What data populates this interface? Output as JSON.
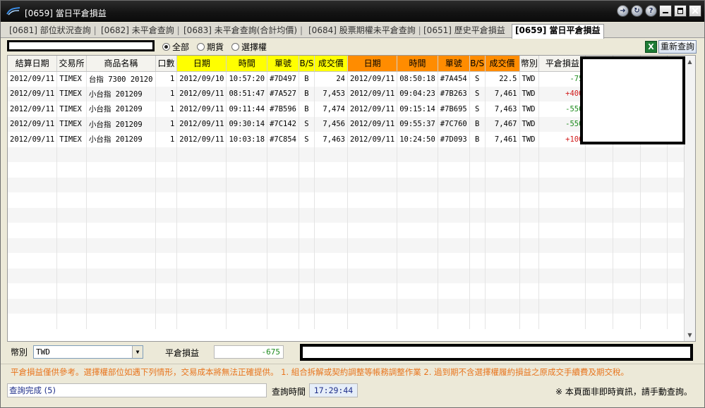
{
  "window": {
    "title": "[0659] 當日平倉損益"
  },
  "titlebar_buttons": [
    "forward-icon",
    "refresh-icon",
    "help-icon",
    "minimize-icon",
    "maximize-icon",
    "close-icon"
  ],
  "tabs": [
    {
      "label": "[0681] 部位狀況查詢",
      "active": false
    },
    {
      "label": "[0682] 未平倉查詢",
      "active": false
    },
    {
      "label": "[0683] 未平倉查詢(合計均價)",
      "active": false
    },
    {
      "label": "[0684] 股票期權未平倉查詢",
      "active": false
    },
    {
      "label": "[0651] 歷史平倉損益",
      "active": false
    },
    {
      "label": "[0659] 當日平倉損益",
      "active": true
    }
  ],
  "filters": {
    "options": [
      {
        "label": "全部",
        "selected": true
      },
      {
        "label": "期貨",
        "selected": false
      },
      {
        "label": "選擇權",
        "selected": false
      }
    ],
    "refresh_label": "重新查詢"
  },
  "columns": [
    "結算日期",
    "交易所",
    "商品名稱",
    "口數",
    "日期",
    "時間",
    "單號",
    "B/S",
    "成交價",
    "日期",
    "時間",
    "單號",
    "B/S",
    "成交價",
    "幣別",
    "平倉損益"
  ],
  "rows": [
    {
      "settle_date": "2012/09/11",
      "exchange": "TIMEX",
      "product": "台指 7300 20120",
      "qty": "1",
      "o_date": "2012/09/10",
      "o_time": "10:57:20",
      "o_no": "#7D497",
      "o_bs": "B",
      "o_price": "24",
      "c_date": "2012/09/11",
      "c_time": "08:50:18",
      "c_no": "#7A454",
      "c_bs": "S",
      "c_price": "22.5",
      "currency": "TWD",
      "pnl": "-75"
    },
    {
      "settle_date": "2012/09/11",
      "exchange": "TIMEX",
      "product": "小台指 201209",
      "qty": "1",
      "o_date": "2012/09/11",
      "o_time": "08:51:47",
      "o_no": "#7A527",
      "o_bs": "B",
      "o_price": "7,453",
      "c_date": "2012/09/11",
      "c_time": "09:04:23",
      "c_no": "#7B263",
      "c_bs": "S",
      "c_price": "7,461",
      "currency": "TWD",
      "pnl": "+400"
    },
    {
      "settle_date": "2012/09/11",
      "exchange": "TIMEX",
      "product": "小台指 201209",
      "qty": "1",
      "o_date": "2012/09/11",
      "o_time": "09:11:44",
      "o_no": "#7B596",
      "o_bs": "B",
      "o_price": "7,474",
      "c_date": "2012/09/11",
      "c_time": "09:15:14",
      "c_no": "#7B695",
      "c_bs": "S",
      "c_price": "7,463",
      "currency": "TWD",
      "pnl": "-550"
    },
    {
      "settle_date": "2012/09/11",
      "exchange": "TIMEX",
      "product": "小台指 201209",
      "qty": "1",
      "o_date": "2012/09/11",
      "o_time": "09:30:14",
      "o_no": "#7C142",
      "o_bs": "S",
      "o_price": "7,456",
      "c_date": "2012/09/11",
      "c_time": "09:55:37",
      "c_no": "#7C760",
      "c_bs": "B",
      "c_price": "7,467",
      "currency": "TWD",
      "pnl": "-550"
    },
    {
      "settle_date": "2012/09/11",
      "exchange": "TIMEX",
      "product": "小台指 201209",
      "qty": "1",
      "o_date": "2012/09/11",
      "o_time": "10:03:18",
      "o_no": "#7C854",
      "o_bs": "S",
      "o_price": "7,463",
      "c_date": "2012/09/11",
      "c_time": "10:24:50",
      "c_no": "#7D093",
      "c_bs": "B",
      "c_price": "7,461",
      "currency": "TWD",
      "pnl": "+100"
    }
  ],
  "footer": {
    "currency_label": "幣別",
    "currency_value": "TWD",
    "pnl_label": "平倉損益",
    "pnl_value": "-675"
  },
  "note": "平倉損益僅供參考。選擇權部位如遇下列情形，交易成本將無法正確提供。  1. 組合拆解或契約調整等帳務調整作業  2. 過到期不含選擇權履約損益之原成交手續費及期交稅。",
  "status": {
    "message": "查詢完成 (5)",
    "time_label": "查詢時間",
    "time_value": "17:29:44",
    "notice": "※ 本頁面非即時資訊，請手動查詢。"
  },
  "colors": {
    "positive": "#d11b1b",
    "negative": "#1c8a1c",
    "open_header": "#ffff00",
    "close_header": "#ff8c00",
    "note": "#e8741c"
  }
}
